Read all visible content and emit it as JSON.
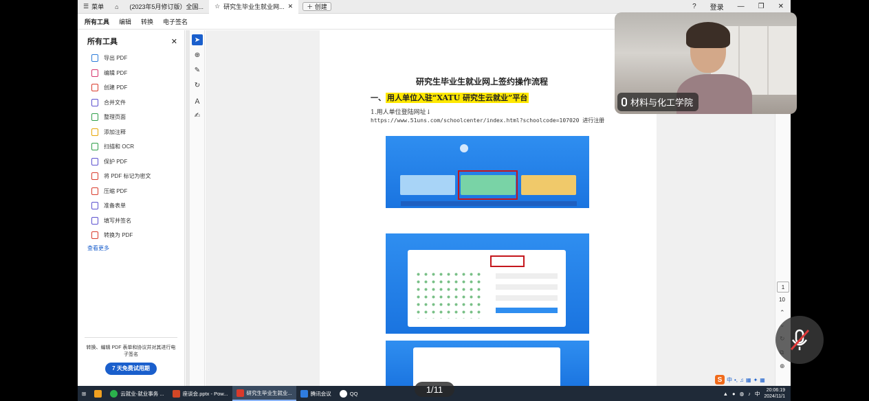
{
  "titlebar": {
    "menu_label": "菜单",
    "tabs": [
      {
        "label": "(2023年5月修订版）全国..."
      },
      {
        "label": "研究生毕业生就业网..."
      }
    ],
    "new_tab_label": "创建",
    "login_label": "登录"
  },
  "tooltabs": [
    "所有工具",
    "编辑",
    "转换",
    "电子签名"
  ],
  "leftpanel": {
    "title": "所有工具",
    "items": [
      {
        "label": "导出 PDF",
        "color": "#2b7bd9"
      },
      {
        "label": "编辑 PDF",
        "color": "#d6336c"
      },
      {
        "label": "创建 PDF",
        "color": "#d93a2b"
      },
      {
        "label": "合并文件",
        "color": "#5a4fcf"
      },
      {
        "label": "整理页面",
        "color": "#2e9e48"
      },
      {
        "label": "添加注释",
        "color": "#e7a400"
      },
      {
        "label": "扫描和 OCR",
        "color": "#2e9e48"
      },
      {
        "label": "保护 PDF",
        "color": "#5a4fcf"
      },
      {
        "label": "将 PDF 标记为密文",
        "color": "#d93a2b"
      },
      {
        "label": "压缩 PDF",
        "color": "#d93a2b"
      },
      {
        "label": "准备表单",
        "color": "#5a4fcf"
      },
      {
        "label": "填写并签名",
        "color": "#5a4fcf"
      },
      {
        "label": "转换为 PDF",
        "color": "#d93a2b"
      }
    ],
    "more_label": "查看更多",
    "footer_text": "转换、编辑 PDF 表单和协议并对其进行电子签名",
    "trial_label": "7 天免费试用期"
  },
  "document": {
    "title": "研究生毕业生就业网上签约操作流程",
    "section1_prefix": "一、",
    "section1_highlight": "用人单位入驻“XATU 研究生云就业”平台",
    "step1": "1.用人单位登陆网址↓",
    "url_text": "https://www.51uns.com/schoolcenter/index.html?schoolcode=107020 进行注册"
  },
  "navigation": {
    "page_current": "1",
    "page_total": "10",
    "page_pill": "1/11"
  },
  "video": {
    "participant_name": "材料与化工学院"
  },
  "taskbar": {
    "items": [
      {
        "label": "云就业-就业事务 ...",
        "color": "#2bb24c"
      },
      {
        "label": "座谈会.pptx - Pow...",
        "color": "#d24726"
      },
      {
        "label": "研究生毕业生就业...",
        "color": "#d93a2b"
      },
      {
        "label": "腾讯会议",
        "color": "#2f7de1"
      },
      {
        "label": "QQ",
        "color": "#ffffff"
      }
    ],
    "ime_labels": [
      "中",
      "简"
    ],
    "time": "20:06:19",
    "date": "2024/11/1"
  }
}
